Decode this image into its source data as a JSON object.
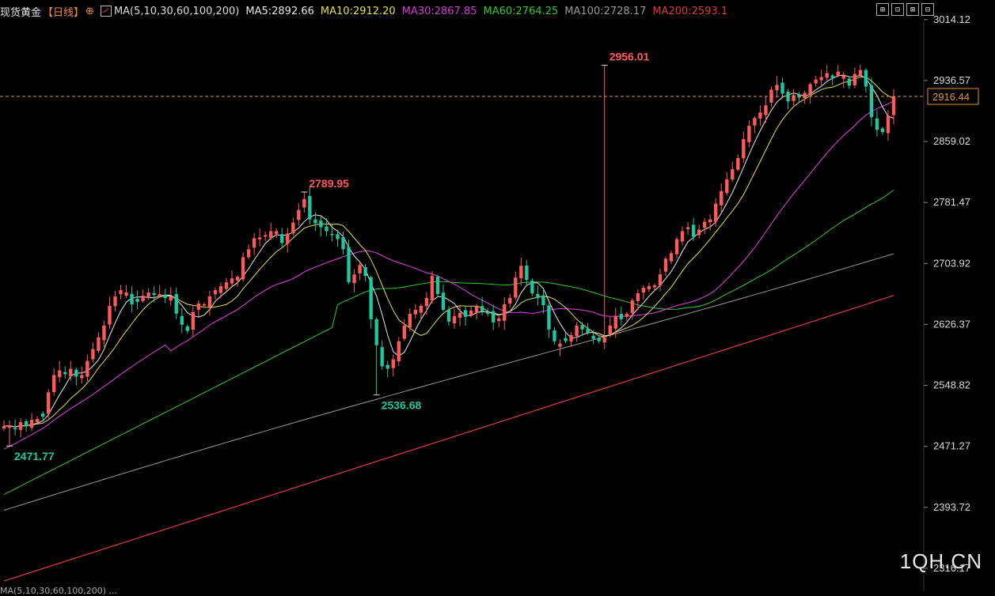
{
  "header": {
    "title": "现货黄金",
    "period": "【日线】",
    "plus_icon": "⊕",
    "ma_label": "MA(5,10,30,60,100,200)",
    "ma_values": [
      {
        "key": "ma5",
        "text": "MA5:2892.66",
        "color": "#e8e8e8"
      },
      {
        "key": "ma10",
        "text": "MA10:2912.20",
        "color": "#e5e04a"
      },
      {
        "key": "ma30",
        "text": "MA30:2867.85",
        "color": "#d43ad4"
      },
      {
        "key": "ma60",
        "text": "MA60:2764.25",
        "color": "#2ecc2e"
      },
      {
        "key": "ma100",
        "text": "MA100:2728.17",
        "color": "#9a9a9a"
      },
      {
        "key": "ma200",
        "text": "MA200:2593.1",
        "color": "#e03a3a"
      }
    ]
  },
  "toolbar": [
    "⊞",
    "⊡",
    "⊠",
    "⊟"
  ],
  "watermark": "1QH.CN",
  "footer": "MA(5,10,30,60,100,200) ...",
  "chart_data": {
    "type": "candlestick",
    "y_ticks": [
      3014.12,
      2936.57,
      2859.02,
      2781.47,
      2703.92,
      2626.37,
      2548.82,
      2471.27,
      2393.72,
      2316.17
    ],
    "ylim": [
      2293,
      3029
    ],
    "last_price": "2916.44",
    "annotations": [
      {
        "text": "2956.01",
        "index": 108,
        "price": 2956.01,
        "type": "high"
      },
      {
        "text": "2789.95",
        "index": 54,
        "price": 2789.95,
        "type": "high"
      },
      {
        "text": "2536.68",
        "index": 67,
        "price": 2536.68,
        "type": "low"
      },
      {
        "text": "2471.77",
        "index": 1,
        "price": 2471.77,
        "type": "low"
      }
    ],
    "closes": [
      2497,
      2498,
      2493,
      2502,
      2497,
      2505,
      2506,
      2509,
      2540,
      2562,
      2568,
      2563,
      2570,
      2560,
      2562,
      2580,
      2595,
      2610,
      2625,
      2650,
      2662,
      2670,
      2667,
      2652,
      2655,
      2663,
      2667,
      2664,
      2665,
      2660,
      2662,
      2640,
      2626,
      2618,
      2642,
      2653,
      2652,
      2662,
      2670,
      2675,
      2680,
      2685,
      2687,
      2712,
      2722,
      2736,
      2737,
      2740,
      2745,
      2745,
      2730,
      2742,
      2756,
      2772,
      2786,
      2760,
      2755,
      2750,
      2745,
      2740,
      2735,
      2722,
      2680,
      2690,
      2702,
      2688,
      2633,
      2600,
      2573,
      2570,
      2582,
      2605,
      2625,
      2640,
      2645,
      2650,
      2660,
      2688,
      2665,
      2645,
      2630,
      2637,
      2641,
      2636,
      2644,
      2649,
      2643,
      2640,
      2629,
      2634,
      2652,
      2660,
      2686,
      2701,
      2683,
      2666,
      2660,
      2651,
      2620,
      2605,
      2602,
      2605,
      2613,
      2625,
      2620,
      2616,
      2608,
      2605,
      2610,
      2625,
      2637,
      2633,
      2640,
      2657,
      2666,
      2673,
      2675,
      2676,
      2690,
      2710,
      2717,
      2735,
      2745,
      2750,
      2738,
      2747,
      2757,
      2760,
      2780,
      2796,
      2811,
      2824,
      2838,
      2862,
      2879,
      2889,
      2896,
      2905,
      2925,
      2931,
      2920,
      2910,
      2918,
      2915,
      2921,
      2932,
      2938,
      2941,
      2946,
      2940,
      2948,
      2943,
      2930,
      2945,
      2950,
      2929,
      2890,
      2874,
      2871,
      2892,
      2916
    ],
    "series_colors": {
      "up": "#ff5a5a",
      "down": "#1fc7a0"
    }
  }
}
